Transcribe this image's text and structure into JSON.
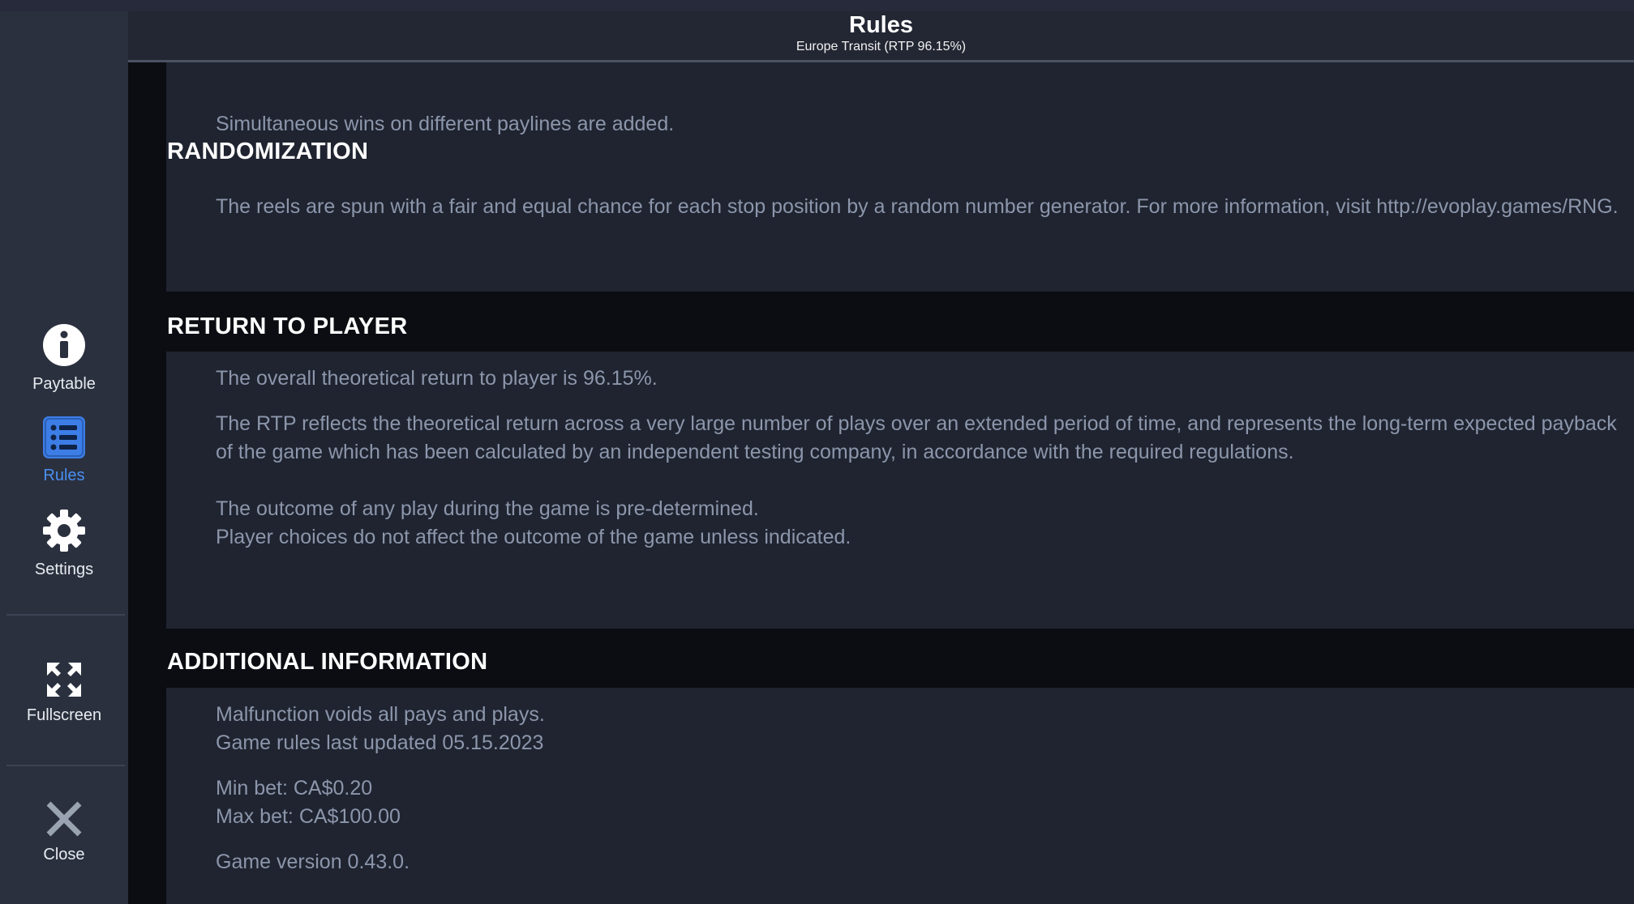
{
  "header": {
    "title": "Rules",
    "subtitle": "Europe Transit (RTP 96.15%)"
  },
  "sidebar": {
    "items": [
      {
        "label": "Paytable",
        "icon": "info-icon"
      },
      {
        "label": "Rules",
        "icon": "list-icon",
        "active": true
      },
      {
        "label": "Settings",
        "icon": "gear-icon"
      },
      {
        "label": "Fullscreen",
        "icon": "fullscreen-icon"
      },
      {
        "label": "Close",
        "icon": "close-icon"
      }
    ]
  },
  "colors": {
    "accent": "#3d7de6",
    "panel": "#1f2430",
    "body_text": "#8c96ab",
    "heading": "#ffffff"
  },
  "sections": {
    "paylines_tail": "Simultaneous wins on different paylines are added.",
    "randomization": {
      "title": "RANDOMIZATION",
      "p1": "The reels are spun with a fair and equal chance for each stop position by a random number generator. For more information, visit http://evoplay.games/RNG."
    },
    "rtp": {
      "title": "RETURN TO PLAYER",
      "p1": "The overall theoretical return to player is 96.15%.",
      "p2": "The RTP reflects the theoretical return across a very large number of plays over an extended period of time, and represents the long-term expected payback of the game which has been calculated by an independent testing company, in accordance with the required regulations.",
      "p3": "The outcome of any play during the game is pre-determined.",
      "p4": "Player choices do not affect the outcome of the game unless indicated."
    },
    "additional": {
      "title": "ADDITIONAL INFORMATION",
      "p1": "Malfunction voids all pays and plays.",
      "p2": "Game rules last updated 05.15.2023",
      "p3": "Min bet: CA$0.20",
      "p4": "Max bet: CA$100.00",
      "p5": "Game version 0.43.0."
    }
  }
}
